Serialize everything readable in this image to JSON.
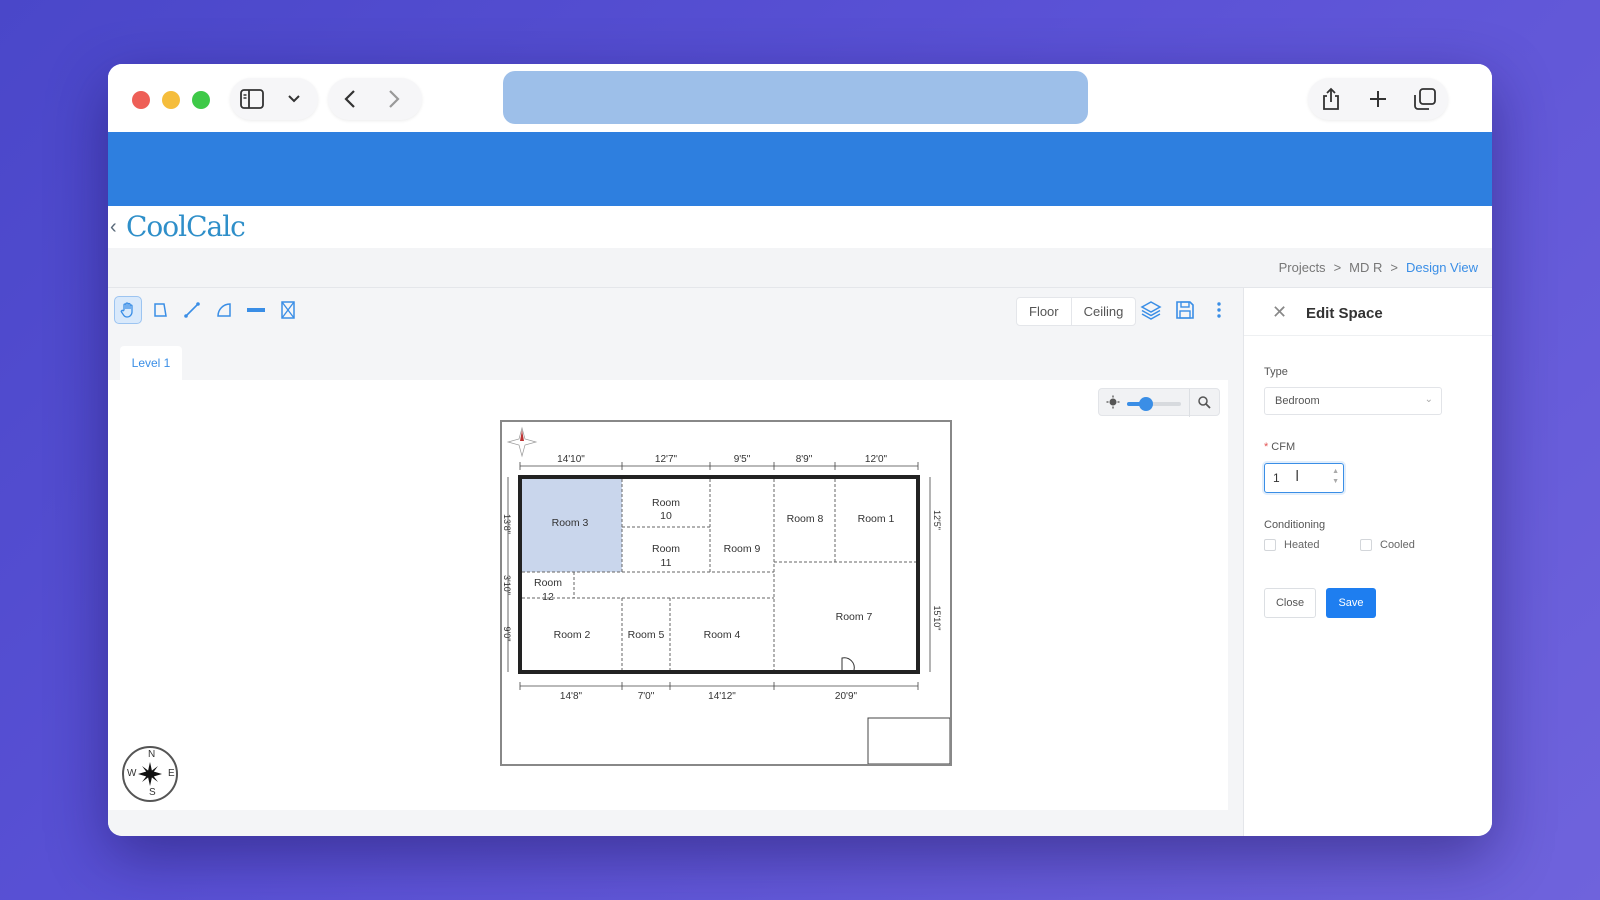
{
  "app": {
    "logo": "CoolCalc"
  },
  "breadcrumb": [
    "Projects",
    "MD R",
    "Design View"
  ],
  "view_buttons": {
    "floor": "Floor",
    "ceiling": "Ceiling"
  },
  "level_tab": "Level 1",
  "floorplan": {
    "top_dims": [
      "14'10\"",
      "12'7\"",
      "9'5\"",
      "8'9\"",
      "12'0\""
    ],
    "bottom_dims": [
      "14'8\"",
      "7'0\"",
      "14'12\"",
      "20'9\""
    ],
    "left_dims": [
      "13'8\"",
      "3'10\"",
      "9'0\""
    ],
    "right_dims": [
      "12'5\"",
      "15'10\""
    ],
    "rooms": [
      "Room 3",
      "Room 10",
      "Room 11",
      "Room 9",
      "Room 8",
      "Room 1",
      "Room 12",
      "Room 2",
      "Room 5",
      "Room 4",
      "Room 7"
    ],
    "selected_room_color": "#c9d6ec"
  },
  "compass": {
    "n": "N",
    "s": "S",
    "e": "E",
    "w": "W"
  },
  "edit_space": {
    "title": "Edit Space",
    "type_label": "Type",
    "type_value": "Bedroom",
    "cfm_label": "CFM",
    "cfm_value": "1",
    "conditioning_label": "Conditioning",
    "heated_label": "Heated",
    "cooled_label": "Cooled",
    "close_label": "Close",
    "save_label": "Save"
  },
  "zoom": {
    "level": 0.35
  },
  "colors": {
    "accent": "#2e7fdf",
    "primary_button": "#1e7ef0"
  }
}
